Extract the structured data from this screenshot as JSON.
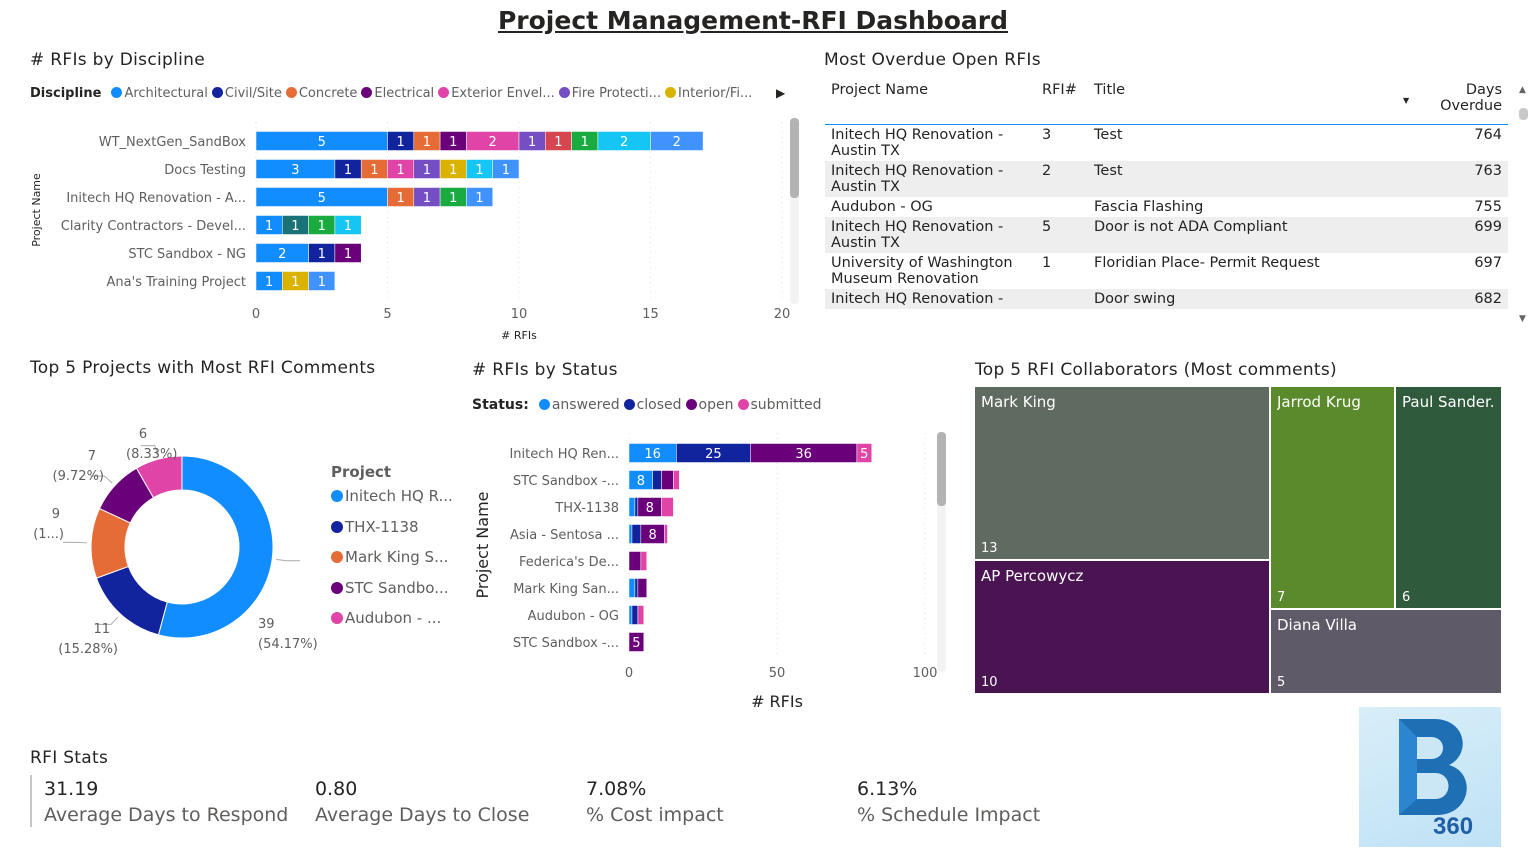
{
  "title": "Project Management-RFI Dashboard",
  "discipline": {
    "visual_title": "# RFIs by Discipline",
    "legend_label": "Discipline",
    "chart_data": {
      "type": "bar",
      "orientation": "horizontal",
      "stacked": true,
      "xlabel": "# RFIs",
      "ylabel": "Project Name",
      "xlim": [
        0,
        20
      ],
      "xticks": [
        0,
        5,
        10,
        15,
        20
      ],
      "grid": true,
      "series": [
        {
          "name": "Architectural",
          "color": "#118DFF"
        },
        {
          "name": "Civil/Site",
          "color": "#12239E"
        },
        {
          "name": "Concrete",
          "color": "#E66C37"
        },
        {
          "name": "Electrical",
          "color": "#6B007B"
        },
        {
          "name": "Exterior Envel...",
          "color": "#E044A7"
        },
        {
          "name": "Fire Protecti...",
          "color": "#744EC2"
        },
        {
          "name": "Interior/Fi...",
          "color": "#D9B300"
        },
        {
          "color": "#D64550"
        },
        {
          "color": "#197278"
        },
        {
          "color": "#1AAB40"
        },
        {
          "color": "#15C6F4"
        },
        {
          "color": "#4092FF"
        }
      ],
      "categories": [
        "WT_NextGen_SandBox",
        "Docs Testing",
        "Initech HQ Renovation - A...",
        "Clarity Contractors - Devel...",
        "STC Sandbox - NG",
        "Ana's Training Project"
      ],
      "values": [
        [
          5,
          1,
          1,
          1,
          2,
          1,
          0,
          1,
          0,
          1,
          2,
          2
        ],
        [
          3,
          1,
          1,
          0,
          1,
          1,
          1,
          0,
          0,
          0,
          1,
          1
        ],
        [
          5,
          0,
          1,
          0,
          0,
          1,
          0,
          0,
          0,
          1,
          0,
          1
        ],
        [
          1,
          0,
          0,
          0,
          0,
          0,
          0,
          0,
          1,
          1,
          1,
          0
        ],
        [
          2,
          1,
          0,
          1,
          0,
          0,
          0,
          0,
          0,
          0,
          0,
          0
        ],
        [
          1,
          0,
          0,
          0,
          0,
          0,
          1,
          0,
          0,
          0,
          0,
          1
        ]
      ]
    }
  },
  "overdue": {
    "visual_title": "Most Overdue Open RFIs",
    "columns": [
      "Project Name",
      "RFI#",
      "Title",
      "Days Overdue"
    ],
    "rows": [
      [
        "Initech HQ Renovation - Austin TX",
        "3",
        "Test",
        "764"
      ],
      [
        "Initech HQ Renovation - Austin TX",
        "2",
        "Test",
        "763"
      ],
      [
        "Audubon - OG",
        "",
        "Fascia Flashing",
        "755"
      ],
      [
        "Initech HQ Renovation - Austin TX",
        "5",
        "Door is not ADA Compliant",
        "699"
      ],
      [
        "University of Washington Museum Renovation",
        "1",
        "Floridian Place- Permit Request",
        "697"
      ],
      [
        "Initech HQ Renovation -",
        "",
        "Door swing",
        "682"
      ]
    ]
  },
  "comments": {
    "visual_title": "Top 5 Projects with Most RFI Comments",
    "legend_title": "Project",
    "chart_data": {
      "type": "pie",
      "donut": true,
      "categories": [
        "Initech HQ R...",
        "THX-1138",
        "Mark King S...",
        "STC Sandbo...",
        "Audubon - ..."
      ],
      "values": [
        39,
        11,
        9,
        7,
        6
      ],
      "labels": [
        "39",
        "11",
        "9",
        "7",
        "6"
      ],
      "percent_labels": [
        "(54.17%)",
        "(15.28%)",
        "(1...)",
        "(9.72%)",
        "(8.33%)"
      ],
      "colors": [
        "#118DFF",
        "#12239E",
        "#E66C37",
        "#6B007B",
        "#E044A7"
      ]
    }
  },
  "status": {
    "visual_title": "# RFIs by Status",
    "legend_label": "Status:",
    "chart_data": {
      "type": "bar",
      "orientation": "horizontal",
      "stacked": true,
      "xlabel": "# RFIs",
      "ylabel": "Project Name",
      "xlim": [
        0,
        100
      ],
      "xticks": [
        0,
        50,
        100
      ],
      "grid": true,
      "series": [
        {
          "name": "answered",
          "color": "#118DFF"
        },
        {
          "name": "closed",
          "color": "#12239E"
        },
        {
          "name": "open",
          "color": "#6B007B"
        },
        {
          "name": "submitted",
          "color": "#E044A7"
        }
      ],
      "categories": [
        "Initech HQ Ren...",
        "STC Sandbox -...",
        "THX-1138",
        "Asia - Sentosa ...",
        "Federica's De...",
        "Mark King San...",
        "Audubon - OG",
        "STC Sandbox -..."
      ],
      "values": [
        [
          16,
          25,
          36,
          5
        ],
        [
          8,
          3,
          4,
          2
        ],
        [
          2,
          1,
          8,
          4
        ],
        [
          1,
          3,
          8,
          1
        ],
        [
          0,
          0,
          4,
          2
        ],
        [
          2,
          1,
          3,
          0
        ],
        [
          1,
          2,
          0,
          2
        ],
        [
          0,
          0,
          5,
          0
        ]
      ],
      "shown_labels": [
        [
          true,
          true,
          true,
          true
        ],
        [
          true,
          false,
          false,
          false
        ],
        [
          false,
          false,
          true,
          false
        ],
        [
          false,
          false,
          true,
          false
        ],
        [
          false,
          false,
          false,
          false
        ],
        [
          false,
          false,
          false,
          false
        ],
        [
          false,
          false,
          false,
          false
        ],
        [
          false,
          false,
          true,
          false
        ]
      ]
    }
  },
  "collaborators": {
    "visual_title": "Top 5 RFI Collaborators (Most comments)",
    "chart_data": {
      "type": "treemap",
      "items": [
        {
          "name": "Mark King",
          "value": 13,
          "color": "#5F6B61"
        },
        {
          "name": "AP Percowycz",
          "value": 10,
          "color": "#4A1453"
        },
        {
          "name": "Jarrod Krug",
          "value": 7,
          "color": "#5B8A2D"
        },
        {
          "name": "Paul Sander...",
          "value": 6,
          "color": "#2F5A3C"
        },
        {
          "name": "Diana Villa",
          "value": 5,
          "color": "#5E5A68"
        }
      ]
    }
  },
  "stats": {
    "visual_title": "RFI Stats",
    "items": [
      {
        "value": "31.19",
        "label": "Average Days to Respond"
      },
      {
        "value": "0.80",
        "label": "Average Days to Close"
      },
      {
        "value": "7.08%",
        "label": "% Cost impact"
      },
      {
        "value": "6.13%",
        "label": "% Schedule Impact"
      }
    ]
  },
  "logo": {
    "text": "360",
    "letter": "B"
  }
}
